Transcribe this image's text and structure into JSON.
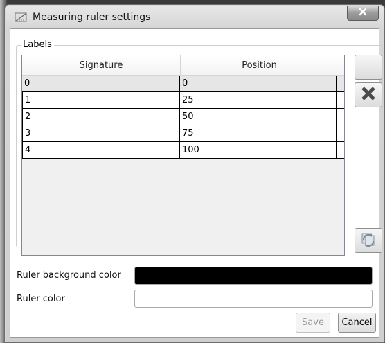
{
  "window": {
    "title": "Measuring ruler settings"
  },
  "labels_group": {
    "title": "Labels",
    "columns": [
      "Signature",
      "Position"
    ],
    "rows": [
      {
        "signature": "0",
        "position": "0"
      },
      {
        "signature": "1",
        "position": "25"
      },
      {
        "signature": "2",
        "position": "50"
      },
      {
        "signature": "3",
        "position": "75"
      },
      {
        "signature": "4",
        "position": "100"
      }
    ]
  },
  "settings": {
    "background_label": "Ruler background color",
    "background_color": "#000000",
    "ruler_label": "Ruler color",
    "ruler_color": "#ffffff"
  },
  "buttons": {
    "save": "Save",
    "cancel": "Cancel"
  },
  "icons": {
    "add": "blank-add-icon",
    "delete": "x-delete-icon",
    "refresh": "refresh-icon",
    "close": "close-icon",
    "app": "ruler-app-icon"
  }
}
